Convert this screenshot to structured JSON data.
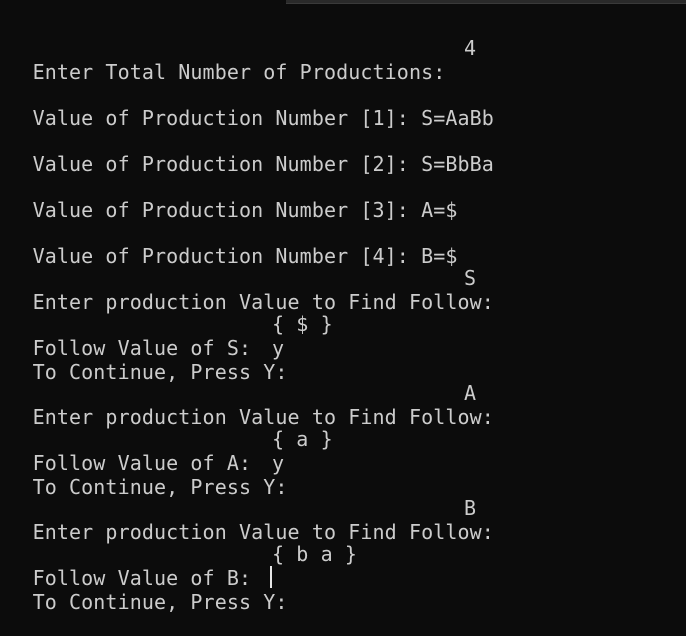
{
  "terminal": {
    "lines": {
      "total_prompt": "Enter Total Number of Productions:",
      "total_value": "4",
      "prod1": "Value of Production Number [1]: S=AaBb",
      "prod2": "Value of Production Number [2]: S=BbBa",
      "prod3": "Value of Production Number [3]: A=$",
      "prod4": "Value of Production Number [4]: B=$",
      "find1_prompt": "Enter production Value to Find Follow:",
      "find1_value": "S",
      "follow1_label": "Follow Value of S:",
      "follow1_value": "{ $ }",
      "cont1_label": "To Continue, Press Y:",
      "cont1_value": "y",
      "find2_prompt": "Enter production Value to Find Follow:",
      "find2_value": "A",
      "follow2_label": "Follow Value of A:",
      "follow2_value": "{ a }",
      "cont2_label": "To Continue, Press Y:",
      "cont2_value": "y",
      "find3_prompt": "Enter production Value to Find Follow:",
      "find3_value": "B",
      "follow3_label": "Follow Value of B:",
      "follow3_value": "{ b a }",
      "cont3_label": "To Continue, Press Y:",
      "cont3_value": ""
    }
  }
}
